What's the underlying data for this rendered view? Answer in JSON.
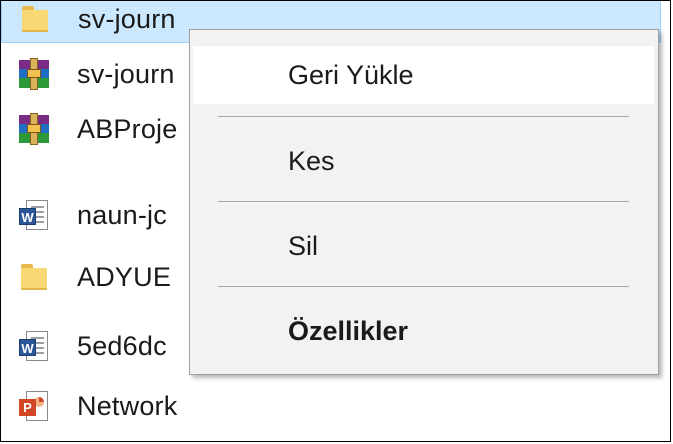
{
  "files": [
    {
      "name": "sv-journ",
      "icon": "folder-icon",
      "selected": true
    },
    {
      "name": "sv-journ",
      "icon": "winrar-archive-icon",
      "selected": false
    },
    {
      "name": "ABProje",
      "icon": "winrar-archive-icon",
      "selected": false
    },
    {
      "name": "naun-jc",
      "icon": "word-document-icon",
      "selected": false
    },
    {
      "name": "ADYUE",
      "icon": "folder-icon",
      "selected": false
    },
    {
      "name": "5ed6dc",
      "icon": "word-document-icon",
      "selected": false
    },
    {
      "name": "Network",
      "icon": "powerpoint-document-icon",
      "selected": false
    }
  ],
  "context_menu": {
    "items": [
      {
        "label": "Geri Yükle",
        "bold": false,
        "highlighted": true
      },
      {
        "label": "Kes",
        "bold": false,
        "highlighted": false
      },
      {
        "label": "Sil",
        "bold": false,
        "highlighted": false
      },
      {
        "label": "Özellikler",
        "bold": true,
        "highlighted": false
      }
    ]
  },
  "colors": {
    "selection_background": "#cce8ff",
    "selection_border": "#99d1ff",
    "menu_background": "#f2f2f2",
    "menu_highlight": "#ffffff"
  }
}
